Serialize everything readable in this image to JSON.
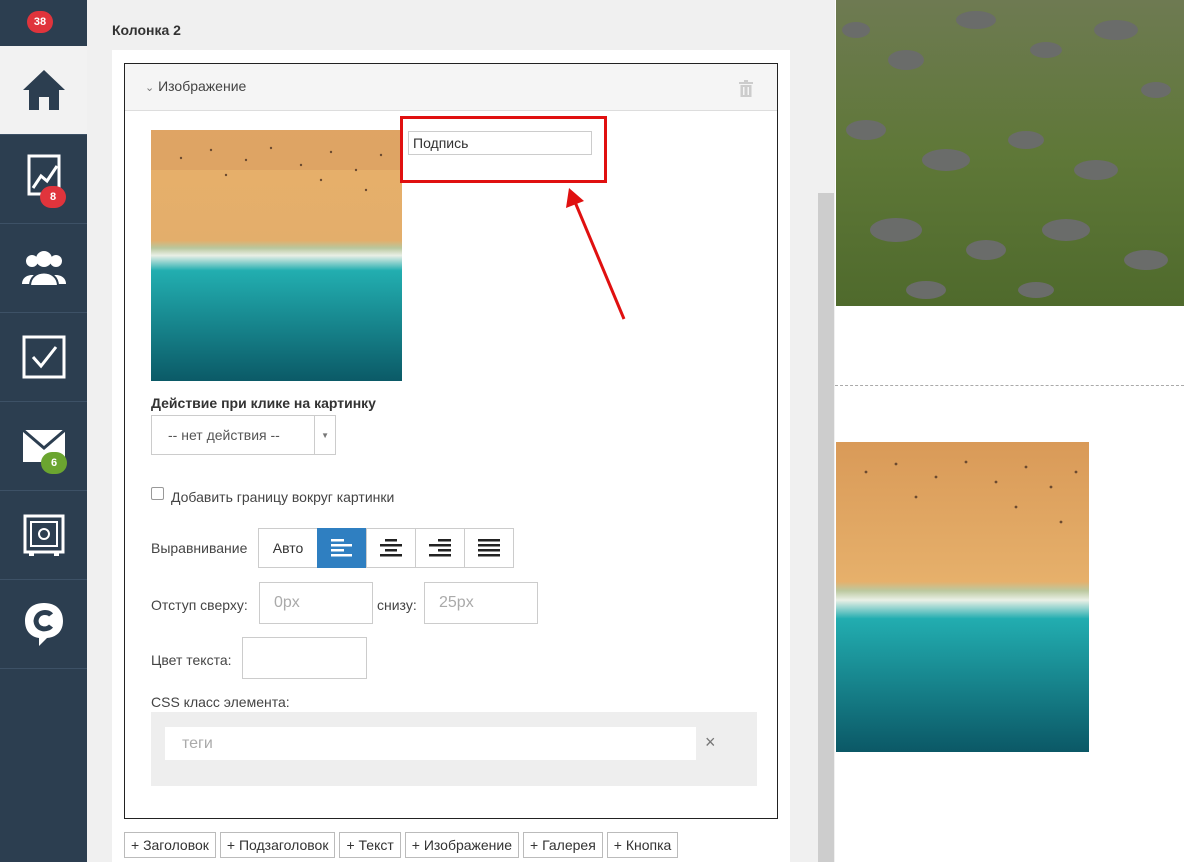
{
  "sidebar": {
    "top_badge": "38",
    "items": [
      {
        "icon": "home-icon",
        "active": true
      },
      {
        "icon": "trend-chart-icon",
        "badge": "8",
        "badge_color": "#e0343c"
      },
      {
        "icon": "users-icon"
      },
      {
        "icon": "checkbox-icon"
      },
      {
        "icon": "mail-icon",
        "badge": "6",
        "badge_color": "#6ba530"
      },
      {
        "icon": "safe-icon"
      },
      {
        "icon": "chat-c-icon"
      }
    ]
  },
  "editor": {
    "column_title": "Колонка 2",
    "block": {
      "title": "Изображение",
      "caption_value": "Подпись",
      "click_action_label": "Действие при клике на картинку",
      "click_action_value": "-- нет действия --",
      "border_checkbox_label": "Добавить границу вокруг картинки",
      "alignment_label": "Выравнивание",
      "alignment_auto": "Авто",
      "alignment_options": [
        "align-left-icon",
        "align-center-icon",
        "align-right-icon",
        "align-justify-icon"
      ],
      "alignment_selected": "left",
      "margin_top_label": "Отступ сверху:",
      "margin_top_placeholder": "0px",
      "margin_bottom_label": "снизу:",
      "margin_bottom_placeholder": "25px",
      "text_color_label": "Цвет текста:",
      "css_class_label": "CSS класс элемента:",
      "tags_placeholder": "теги",
      "tags_clear": "×"
    },
    "add_buttons": [
      "+ Заголовок",
      "+ Подзаголовок",
      "+ Текст",
      "+ Изображение",
      "+ Галерея",
      "+ Кнопка"
    ]
  },
  "colors": {
    "sidebar_bg": "#2c3e50",
    "accent_blue": "#2f7fc1",
    "highlight_red": "#e01010",
    "badge_red": "#e0343c",
    "badge_green": "#6ba530"
  }
}
